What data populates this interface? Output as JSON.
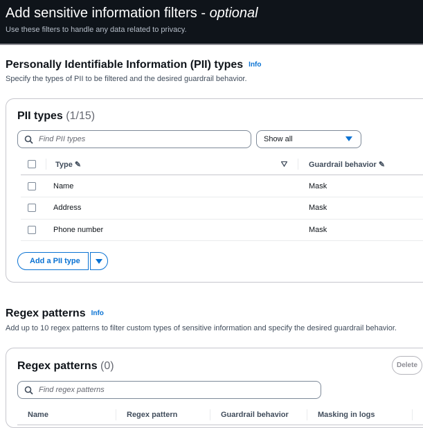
{
  "header": {
    "title": "Add sensitive information filters - ",
    "title_suffix": "optional",
    "subtitle": "Use these filters to handle any data related to privacy."
  },
  "pii_section": {
    "title": "Personally Identifiable Information (PII) types",
    "info": "Info",
    "description": "Specify the types of PII to be filtered and the desired guardrail behavior.",
    "table": {
      "title": "PII types",
      "count": "(1/15)",
      "search_placeholder": "Find PII types",
      "filter_value": "Show all",
      "columns": [
        "Type",
        "Guardrail behavior"
      ],
      "rows": [
        {
          "type": "Name",
          "behavior": "Mask"
        },
        {
          "type": "Address",
          "behavior": "Mask"
        },
        {
          "type": "Phone number",
          "behavior": "Mask"
        }
      ],
      "add_button": "Add a PII type"
    }
  },
  "regex_section": {
    "title": "Regex patterns",
    "info": "Info",
    "description": "Add up to 10 regex patterns to filter custom types of sensitive information and specify the desired guardrail behavior.",
    "table": {
      "title": "Regex patterns",
      "count": "(0)",
      "delete_button": "Delete",
      "search_placeholder": "Find regex patterns",
      "columns": [
        "Name",
        "Regex pattern",
        "Guardrail behavior",
        "Masking in logs"
      ]
    }
  },
  "colors": {
    "header_bg": "#0f141a",
    "link": "#0972d3"
  }
}
